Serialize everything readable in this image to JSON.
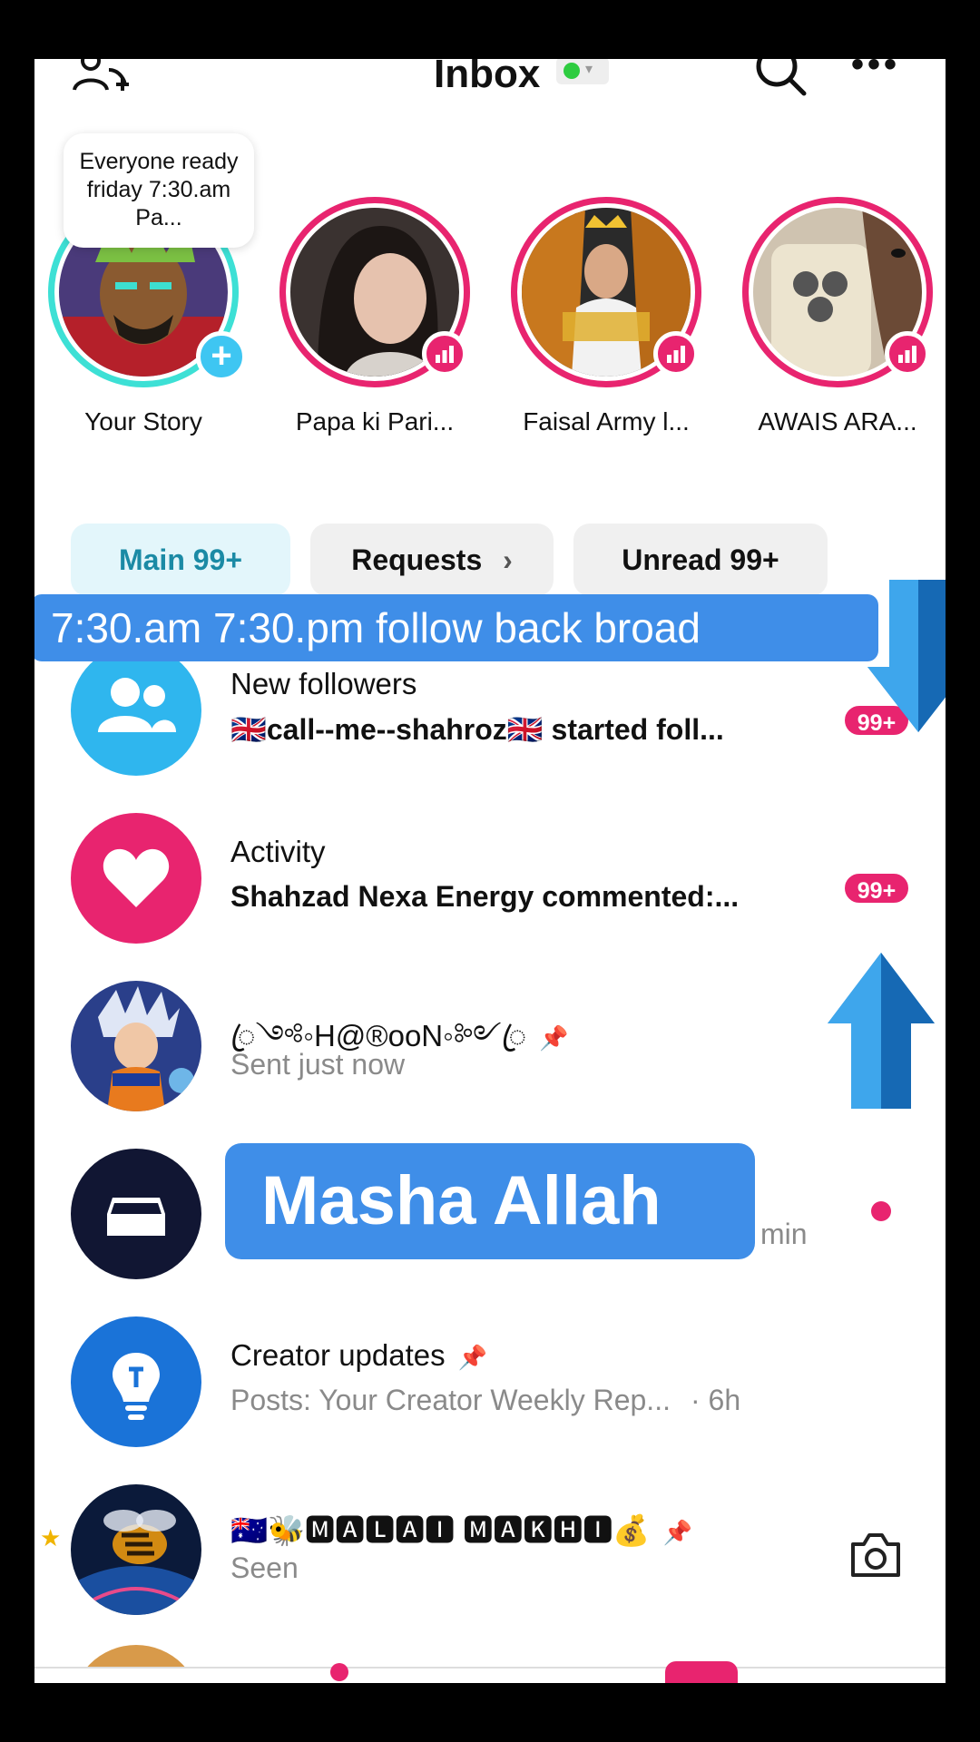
{
  "header": {
    "title": "Inbox",
    "add_friends_icon": "add-friends-icon",
    "search_icon": "search-icon",
    "more_icon": "more-horizontal-icon",
    "more_glyph": "•••"
  },
  "stories": [
    {
      "name": "Your Story",
      "note": "Everyone ready friday 7:30.am Pa...",
      "plus": "+"
    },
    {
      "name": "Papa ki Pari..."
    },
    {
      "name": "Faisal Army l..."
    },
    {
      "name": "AWAIS  ARA..."
    }
  ],
  "filters": [
    {
      "label": "Main 99+",
      "active": true
    },
    {
      "label": "Requests",
      "chevron": "›"
    },
    {
      "label": "Unread 99+"
    }
  ],
  "caption_overlay": "7:30.am 7:30.pm follow back broad",
  "center_overlay": "Masha Allah",
  "messages": [
    {
      "title": "New followers",
      "subtitle": "🇬🇧call--me--shahroz🇬🇧 started foll...",
      "badge": "99+"
    },
    {
      "title": "Activity",
      "subtitle": "Shahzad Nexa Energy commented:...",
      "badge": "99+"
    },
    {
      "title": "ꦿ༺◦H@®ooN◦༻ꦿ",
      "subtitle": "Sent just now",
      "pin": "📌"
    },
    {
      "title": "",
      "subtitle_tail": "min"
    },
    {
      "title": "Creator updates",
      "subtitle": "Posts: Your Creator Weekly Rep...",
      "time": "· 6h",
      "pin": "📌"
    },
    {
      "title": "🇦🇺🐝🅼🅰🅻🅰🅸  🅼🅰🅺🅷🅸💰",
      "subtitle": "Seen",
      "pin": "📌",
      "star": "★"
    }
  ],
  "colors": {
    "accent_pink": "#e8246f",
    "accent_blue": "#3f8ee8",
    "own_story_ring": "#3de0d5",
    "active_chip_text": "#1b8aa5"
  }
}
